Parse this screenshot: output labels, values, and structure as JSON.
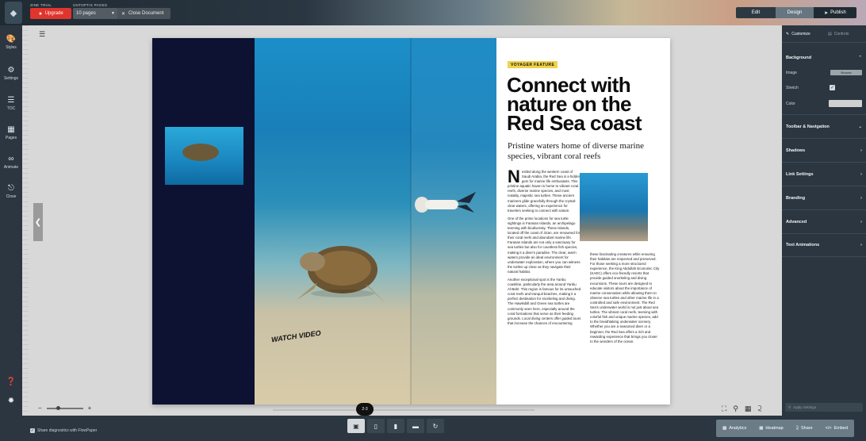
{
  "topbar": {
    "trial_caption": "ZINE TRIAL",
    "upgrade_label": "Upgrade",
    "pages_caption": "UNTOPTIS PAGES",
    "pages_value": "10 pages",
    "close_doc_label": "Close Document",
    "mode_edit": "Edit",
    "mode_design": "Design",
    "mode_publish": "Publish"
  },
  "leftbar": {
    "styles": "Styles",
    "settings": "Settings",
    "toc": "TOC",
    "pages": "Pages",
    "animate": "Animate",
    "close": "Close"
  },
  "document": {
    "tag": "VOYAGER FEATURE",
    "headline": "Connect with nature on the Red Sea coast",
    "subhead": "Pristine waters home of diverse marine species, vibrant coral reefs",
    "dropcap": "N",
    "col1_p1": "estled along the western coast of Saudi Arabia, the Red Sea is a hidden gem for marine life enthusiasts. This pristine aquatic haven is home to vibrant coral reefs, diverse marine species, and most notably, majestic sea turtles. These ancient mariners glide gracefully through the crystal-clear waters, offering an experience for travelers seeking to connect with nature.",
    "col1_p2": "One of the prime locations for sea turtle sightings is Farasan Islands, an archipelago teeming with biodiversity. These islands, located off the coast of Jizan, are renowned for their coral reefs and abundant marine life. Farasan Islands are not only a sanctuary for sea turtles but also for countless fish species, making it a diver's paradise. The clear, warm waters provide an ideal environment for underwater exploration, where you can witness the turtles up close as they navigate their natural habitat.",
    "col1_p3": "Another exceptional spot is the Yanbu coastline, particularly the area around Yanbu Al-Bahr. This region is famous for its untouched coral reefs and tranquil beaches, making it a perfect destination for snorkeling and diving. The Hawksbill and Green sea turtles are commonly seen here, especially around the coral formations that serve as their feeding grounds. Local diving centers offer guided tours that increase the chances of encountering",
    "col2_p1": "these fascinating creatures while ensuring their habitats are respected and preserved. For those seeking a more structured experience, the King Abdullah Economic City (KAEC) offers eco-friendly resorts that provide guided snorkeling and diving excursions. These tours are designed to educate visitors about the importance of marine conservation while allowing them to observe sea turtles and other marine life in a controlled and safe environment. The Red Sea's underwater world is not just about sea turtles. The vibrant coral reefs, teeming with colorful fish and unique marine species, add to the breathtaking underwater scenery. Whether you are a seasoned diver or a beginner, the Red Sea offers a rich and rewarding experience that brings you closer to the wonders of the ocean.",
    "watch_video": "WATCH VIDEO",
    "page_badge": "2-3"
  },
  "rightpanel": {
    "tab_customize": "Customize",
    "tab_controls": "Controls",
    "background": "Background",
    "image_label": "Image",
    "browse_label": "Browse",
    "stretch_label": "Stretch",
    "color_label": "Color",
    "toolbar_nav": "Toolbar & Navigation",
    "shadows": "Shadows",
    "link_settings": "Link Settings",
    "branding": "Branding",
    "advanced": "Advanced",
    "text_animations": "Text Animations",
    "search_placeholder": "Apply Settings"
  },
  "bottombar": {
    "diagnostics": "Share diagnostics with FlowPaper",
    "analytics": "Analytics",
    "heatmap": "Heatmap",
    "share": "Share",
    "embed": "Embed"
  },
  "colors": {
    "accent_red": "#e0342d",
    "panel_dark": "#2b3640",
    "tag_yellow": "#f1d34a",
    "navy": "#0d1233"
  }
}
